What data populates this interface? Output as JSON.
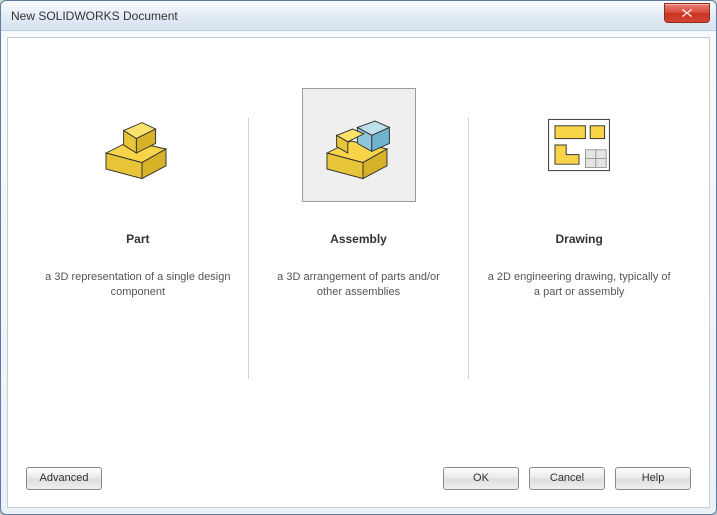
{
  "window": {
    "title": "New SOLIDWORKS Document"
  },
  "options": {
    "part": {
      "title": "Part",
      "description": "a 3D representation of a single design component"
    },
    "assembly": {
      "title": "Assembly",
      "description": "a 3D arrangement of parts and/or other assemblies"
    },
    "drawing": {
      "title": "Drawing",
      "description": "a 2D engineering drawing, typically of a part or assembly"
    }
  },
  "buttons": {
    "advanced": "Advanced",
    "ok": "OK",
    "cancel": "Cancel",
    "help": "Help"
  },
  "selected": "assembly"
}
